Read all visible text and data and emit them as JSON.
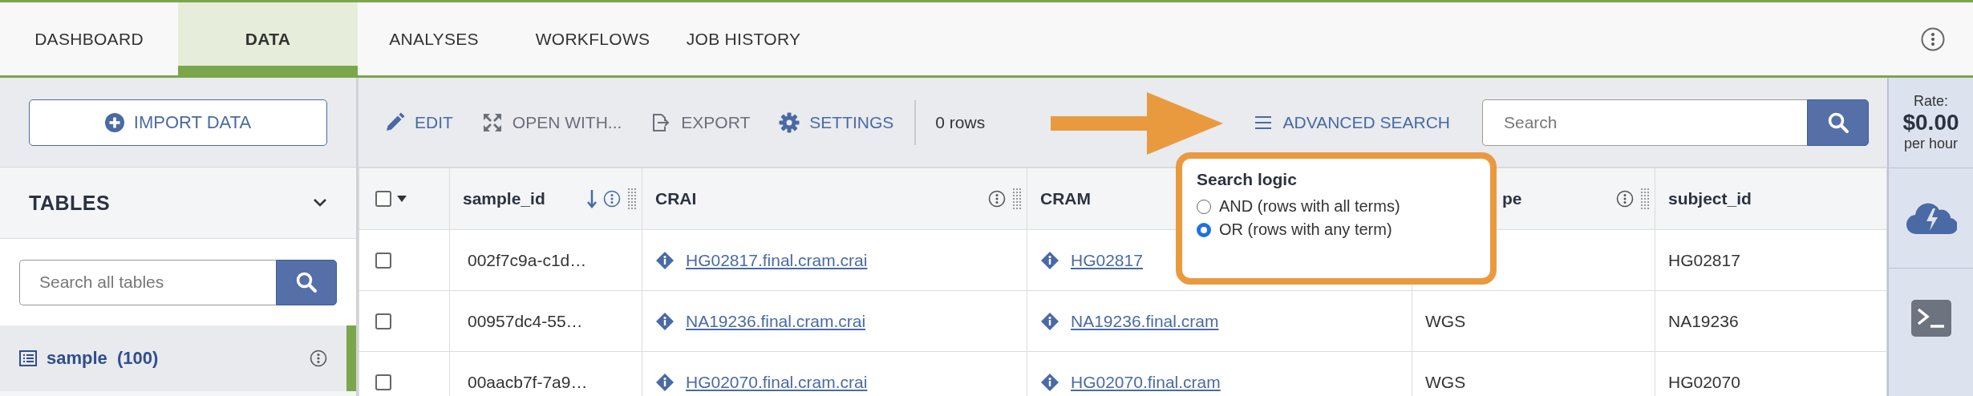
{
  "nav": {
    "tabs": [
      {
        "label": "DASHBOARD",
        "selected": false
      },
      {
        "label": "DATA",
        "selected": true
      },
      {
        "label": "ANALYSES",
        "selected": false
      },
      {
        "label": "WORKFLOWS",
        "selected": false
      },
      {
        "label": "JOB HISTORY",
        "selected": false
      }
    ]
  },
  "sidebar": {
    "import_button": "IMPORT DATA",
    "tables_heading": "TABLES",
    "search": {
      "placeholder": "Search all tables"
    },
    "items": [
      {
        "name": "sample",
        "count": "(100)",
        "selected": true
      }
    ]
  },
  "toolbar": {
    "actions": [
      {
        "kind": "edit",
        "label": "EDIT",
        "disabled": false
      },
      {
        "kind": "open",
        "label": "OPEN WITH...",
        "disabled": true
      },
      {
        "kind": "export",
        "label": "EXPORT",
        "disabled": true
      },
      {
        "kind": "settings",
        "label": "SETTINGS",
        "disabled": false
      }
    ],
    "selection_status": "0 rows",
    "advanced_search": "ADVANCED SEARCH",
    "search": {
      "placeholder": "Search"
    }
  },
  "rate": {
    "label": "Rate:",
    "amount": "$0.00",
    "unit": "per hour"
  },
  "table": {
    "header_checkbox": {
      "checked": false
    },
    "columns": [
      {
        "label": "sample_id",
        "sorted": true,
        "info": true
      },
      {
        "label": "CRAI",
        "sorted": false,
        "info": true
      },
      {
        "label": "CRAM",
        "sorted": false,
        "info": false
      },
      {
        "label": "pe",
        "sorted": false,
        "info": true
      },
      {
        "label": "subject_id",
        "sorted": false,
        "info": false
      }
    ],
    "rows": [
      {
        "checked": false,
        "cells": [
          {
            "kind": "text",
            "text": "002f7c9a-c1d…"
          },
          {
            "kind": "link",
            "text": "HG02817.final.cram.crai"
          },
          {
            "kind": "link",
            "text": "HG02817"
          },
          {
            "kind": "covered"
          },
          {
            "kind": "text",
            "text": "HG02817"
          }
        ]
      },
      {
        "checked": false,
        "cells": [
          {
            "kind": "text",
            "text": "00957dc4-55…"
          },
          {
            "kind": "link",
            "text": "NA19236.final.cram.crai"
          },
          {
            "kind": "link",
            "text": "NA19236.final.cram"
          },
          {
            "kind": "text",
            "text": "WGS"
          },
          {
            "kind": "text",
            "text": "NA19236"
          }
        ]
      },
      {
        "checked": false,
        "cells": [
          {
            "kind": "text",
            "text": "00aacb7f-7a9…"
          },
          {
            "kind": "link",
            "text": "HG02070.final.cram.crai"
          },
          {
            "kind": "link",
            "text": "HG02070.final.cram"
          },
          {
            "kind": "text",
            "text": "WGS"
          },
          {
            "kind": "text",
            "text": "HG02070"
          }
        ]
      }
    ]
  },
  "search_popup": {
    "title": "Search logic",
    "options": [
      {
        "label": "AND (rows with all terms)",
        "selected": false
      },
      {
        "label": "OR (rows with any term)",
        "selected": true
      }
    ]
  }
}
